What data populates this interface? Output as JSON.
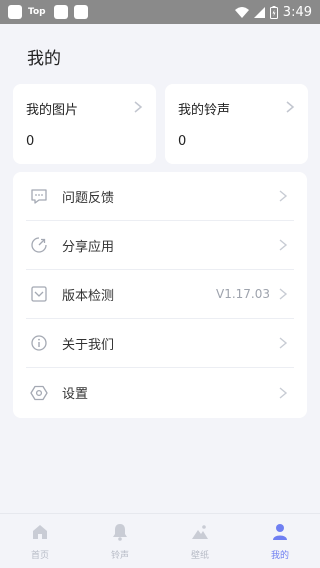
{
  "statusbar": {
    "top": "Top",
    "time": "3:49"
  },
  "page": {
    "title": "我的"
  },
  "cards": [
    {
      "title": "我的图片",
      "count": "0"
    },
    {
      "title": "我的铃声",
      "count": "0"
    }
  ],
  "menu": [
    {
      "label": "问题反馈"
    },
    {
      "label": "分享应用"
    },
    {
      "label": "版本检测",
      "value": "V1.17.03"
    },
    {
      "label": "关于我们"
    },
    {
      "label": "设置"
    }
  ],
  "nav": [
    {
      "label": "首页",
      "icon": "home-icon"
    },
    {
      "label": "铃声",
      "icon": "bell-icon"
    },
    {
      "label": "壁纸",
      "icon": "wallpaper-icon"
    },
    {
      "label": "我的",
      "icon": "user-icon",
      "active": true
    }
  ],
  "colors": {
    "accent": "#6f7ff2",
    "background": "#f3f4f9"
  }
}
